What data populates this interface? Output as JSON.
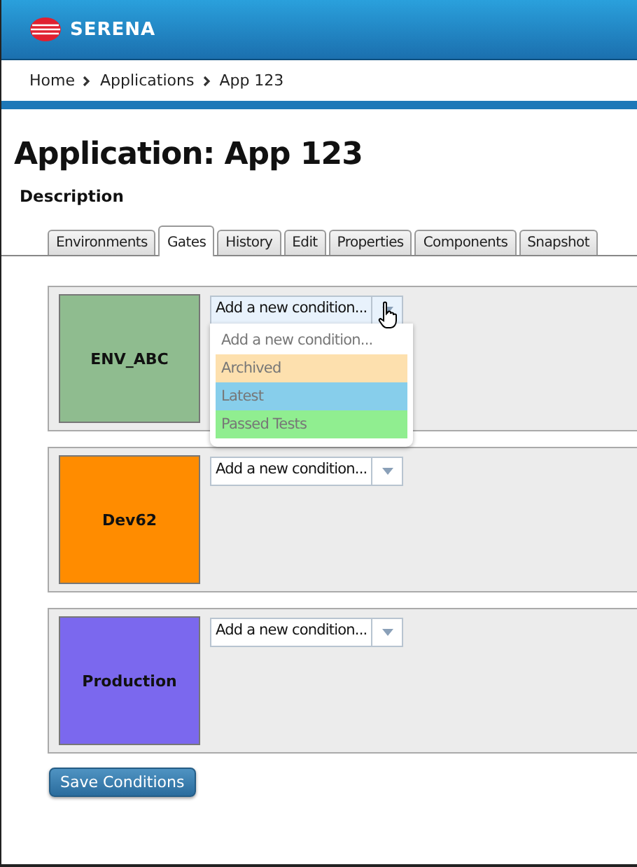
{
  "header": {
    "logo": "SERENA"
  },
  "breadcrumb": [
    "Home",
    "Applications",
    "App 123"
  ],
  "page": {
    "title": "Application: App 123",
    "section": "Description"
  },
  "tabs": [
    {
      "label": "Environments",
      "selected": false
    },
    {
      "label": "Gates",
      "selected": true
    },
    {
      "label": "History",
      "selected": false
    },
    {
      "label": "Edit",
      "selected": false
    },
    {
      "label": "Properties",
      "selected": false
    },
    {
      "label": "Components",
      "selected": false
    },
    {
      "label": "Snapshot",
      "selected": false
    }
  ],
  "gates": [
    {
      "name": "ENV_ABC",
      "color": "#8fbc8f",
      "condition": {
        "value": "Add a new condition...",
        "expanded": true,
        "options": [
          {
            "label": "Add a new condition..."
          },
          {
            "label": "Archived",
            "color": "#fde0ae"
          },
          {
            "label": "Latest",
            "color": "#87ceeb"
          },
          {
            "label": "Passed Tests",
            "color": "#90ee90"
          }
        ]
      }
    },
    {
      "name": "Dev62",
      "color": "#ff8c00",
      "condition": {
        "value": "Add a new condition...",
        "expanded": false
      }
    },
    {
      "name": "Production",
      "color": "#7b68ee",
      "condition": {
        "value": "Add a new condition...",
        "expanded": false
      }
    }
  ],
  "save_button": "Save Conditions"
}
